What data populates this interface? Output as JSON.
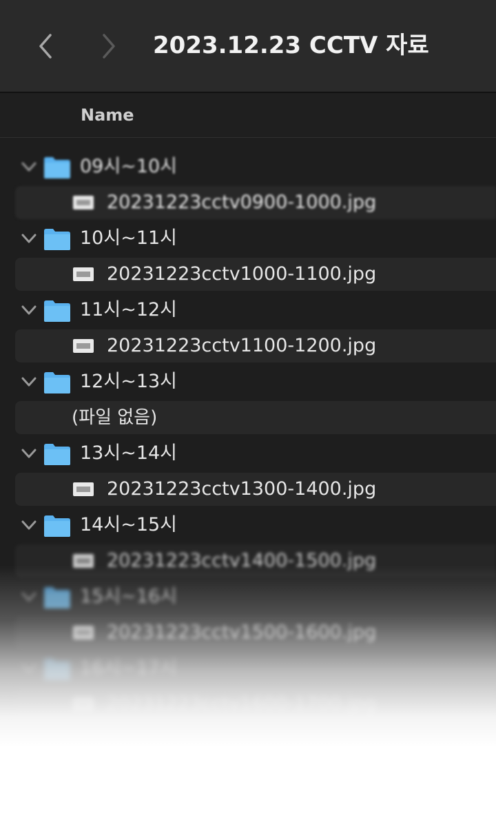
{
  "window": {
    "title": "2023.12.23 CCTV 자료",
    "back_icon": "chevron-left-icon",
    "forward_icon": "chevron-right-icon"
  },
  "columns": {
    "name_header": "Name"
  },
  "groups": [
    {
      "folder": "09시~10시",
      "file": "20231223cctv0900-1000.jpg",
      "empty": false
    },
    {
      "folder": "10시~11시",
      "file": "20231223cctv1000-1100.jpg",
      "empty": false
    },
    {
      "folder": "11시~12시",
      "file": "20231223cctv1100-1200.jpg",
      "empty": false
    },
    {
      "folder": "12시~13시",
      "file": "(파일 없음)",
      "empty": true
    },
    {
      "folder": "13시~14시",
      "file": "20231223cctv1300-1400.jpg",
      "empty": false
    },
    {
      "folder": "14시~15시",
      "file": "20231223cctv1400-1500.jpg",
      "empty": false
    },
    {
      "folder": "15시~16시",
      "file": "20231223cctv1500-1600.jpg",
      "empty": false
    },
    {
      "folder": "16시~17시",
      "file": "20231223cctv1600-1700.jpg",
      "empty": false
    }
  ],
  "colors": {
    "background": "#1e1e1e",
    "titlebar": "#2a2a2a",
    "folder_icon": "#5ab2ef",
    "row_highlight": "#282828"
  }
}
